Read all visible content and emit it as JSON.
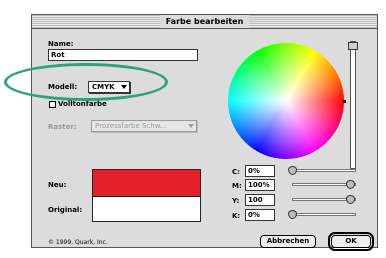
{
  "dialog": {
    "title": "Farbe bearbeiten"
  },
  "name": {
    "label": "Name:",
    "value": "Rot"
  },
  "modell": {
    "label": "Modell:",
    "value": "CMYK"
  },
  "volltonfarbe": {
    "label": "Volltonfarbe",
    "checked": false
  },
  "raster": {
    "label": "Raster:",
    "value": "Prozessfarbe Schw..."
  },
  "preview": {
    "new_label": "Neu:",
    "original_label": "Original:",
    "new_color": "#e4202a",
    "original_color": "#ffffff"
  },
  "cmyk": [
    {
      "label": "C:",
      "value": "0%",
      "level": 0
    },
    {
      "label": "M:",
      "value": "100%",
      "level": 100
    },
    {
      "label": "Y:",
      "value": "100",
      "level": 100
    },
    {
      "label": "K:",
      "value": "0%",
      "level": 0
    }
  ],
  "copyright": "© 1999, Quark, Inc.",
  "buttons": {
    "cancel": "Abbrechen",
    "ok": "OK"
  },
  "colors": {
    "annotation": "#2aa381"
  },
  "icons": [
    "popup-arrow-icon",
    "color-wheel",
    "slider-thumb-icon"
  ]
}
